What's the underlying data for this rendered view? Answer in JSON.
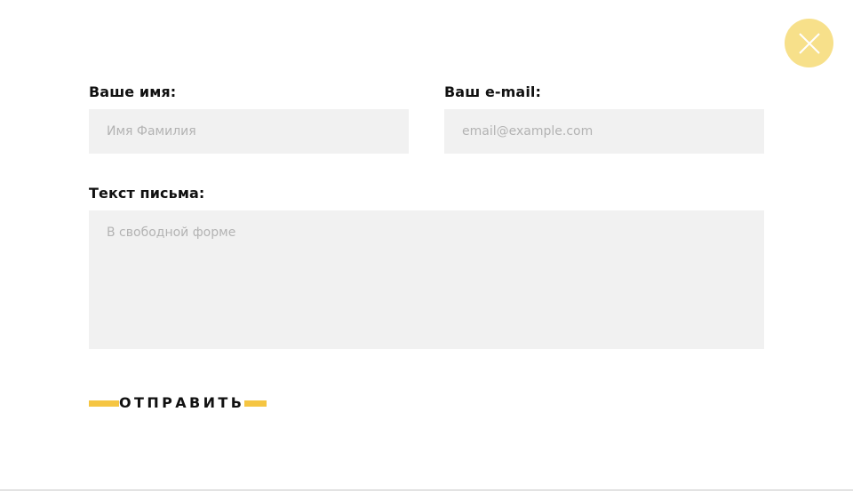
{
  "form": {
    "name": {
      "label": "Ваше имя:",
      "placeholder": "Имя Фамилия",
      "value": ""
    },
    "email": {
      "label": "Ваш e-mail:",
      "placeholder": "email@example.com",
      "value": ""
    },
    "message": {
      "label": "Текст письма:",
      "placeholder": "В свободной форме",
      "value": ""
    },
    "submit_label": "ОТПРАВИТЬ"
  },
  "close": {
    "icon": "close-icon"
  },
  "colors": {
    "accent": "#f5c542",
    "close_bg": "#f7e08a",
    "field_bg": "#f1f1f1",
    "placeholder": "#b3b3b3",
    "text": "#111111"
  }
}
